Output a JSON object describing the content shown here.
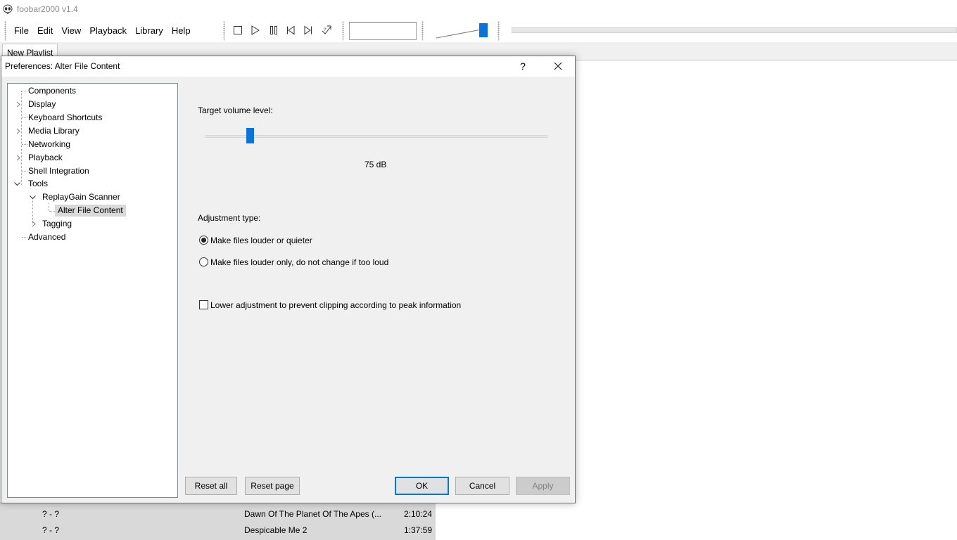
{
  "app": {
    "title": "foobar2000 v1.4",
    "icon": "alien-head-icon"
  },
  "menu": [
    "File",
    "Edit",
    "View",
    "Playback",
    "Library",
    "Help"
  ],
  "toolbar": {
    "buttons": [
      "stop-icon",
      "play-icon",
      "pause-icon",
      "previous-icon",
      "next-icon",
      "random-icon"
    ],
    "volume_level": 0.9
  },
  "playlist_tab": "New Playlist",
  "playlist_rows": [
    {
      "artist": "? - ?",
      "title": "Dawn Of The Planet Of The Apes (...",
      "duration": "2:10:24"
    },
    {
      "artist": "? - ?",
      "title": "Despicable Me 2",
      "duration": "1:37:59"
    }
  ],
  "dialog": {
    "title": "Preferences: Alter File Content",
    "help": "?",
    "tree": [
      {
        "label": "Components",
        "level": 0,
        "expander": "none"
      },
      {
        "label": "Display",
        "level": 0,
        "expander": "collapsed"
      },
      {
        "label": "Keyboard Shortcuts",
        "level": 0,
        "expander": "none"
      },
      {
        "label": "Media Library",
        "level": 0,
        "expander": "collapsed"
      },
      {
        "label": "Networking",
        "level": 0,
        "expander": "none"
      },
      {
        "label": "Playback",
        "level": 0,
        "expander": "collapsed"
      },
      {
        "label": "Shell Integration",
        "level": 0,
        "expander": "none"
      },
      {
        "label": "Tools",
        "level": 0,
        "expander": "expanded"
      },
      {
        "label": "ReplayGain Scanner",
        "level": 1,
        "expander": "expanded"
      },
      {
        "label": "Alter File Content",
        "level": 2,
        "expander": "none",
        "selected": true
      },
      {
        "label": "Tagging",
        "level": 1,
        "expander": "collapsed"
      },
      {
        "label": "Advanced",
        "level": 0,
        "expander": "none"
      }
    ],
    "target_label": "Target volume level:",
    "target_value": "75 dB",
    "target_slider_fraction": 0.13,
    "adjustment_label": "Adjustment type:",
    "radio_louder_quieter": "Make files louder or quieter",
    "radio_louder_only": "Make files louder only, do not change if too loud",
    "selected_radio": "louder_quieter",
    "checkbox_clipping": "Lower adjustment to prevent clipping according to peak information",
    "checkbox_checked": false,
    "buttons": {
      "reset_all": "Reset all",
      "reset_page": "Reset page",
      "ok": "OK",
      "cancel": "Cancel",
      "apply": "Apply"
    }
  },
  "colors": {
    "accent": "#0a74da",
    "selection": "#d9d9d9",
    "dialog_bg": "#f0f0f0"
  }
}
